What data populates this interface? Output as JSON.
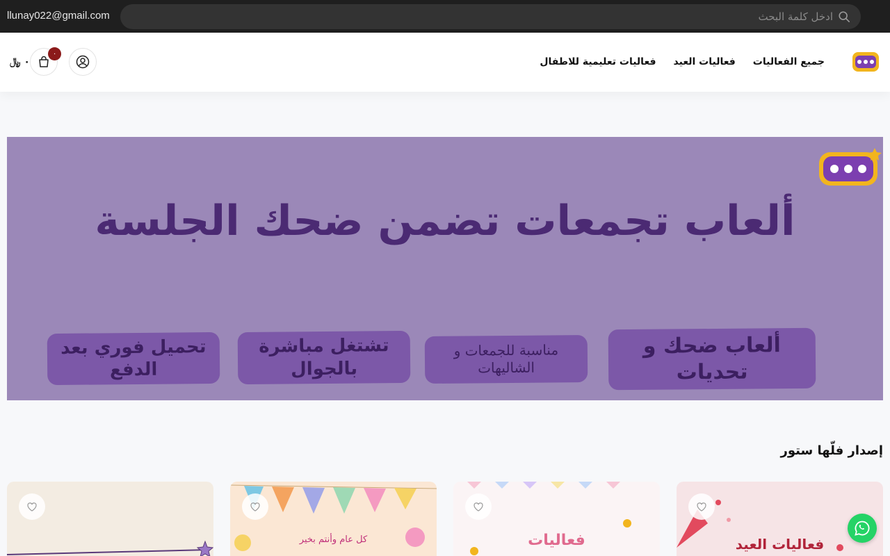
{
  "topbar": {
    "email": "llunay022@gmail.com",
    "search_placeholder": "ادخل كلمة البحث"
  },
  "nav": {
    "items": [
      "جميع الفعاليات",
      "فعاليات العيد",
      "فعاليات تعليمية للاطفال"
    ]
  },
  "header": {
    "cart_count": "٠",
    "cart_total": "٠ ﷼"
  },
  "banner": {
    "title": "ألعاب تجمعات تضمن ضحك الجلسة",
    "features": [
      "ألعاب ضحك و تحديات",
      "مناسبة للجمعات و الشاليهات",
      "تشتغل مباشرة بالجوال",
      "تحميل فوري بعد الدفع"
    ]
  },
  "section": {
    "title": "إصدار فلّها ستور"
  },
  "products": [
    {
      "caption": "فعاليات العيد",
      "bg": "#f6e4e6"
    },
    {
      "caption": "فعاليات",
      "bg": "#fbf4f5"
    },
    {
      "caption": "كل عام وأنتم بخير",
      "bg": "#fbe7d4"
    },
    {
      "caption": "",
      "bg": "#f3ece2"
    }
  ],
  "colors": {
    "accent": "#4b2a73",
    "banner_bg": "#9b88b8",
    "badge": "#8b1a1a",
    "whatsapp": "#25d366"
  },
  "icons": [
    "search-icon",
    "user-icon",
    "cart-icon",
    "heart-icon",
    "whatsapp-icon"
  ]
}
